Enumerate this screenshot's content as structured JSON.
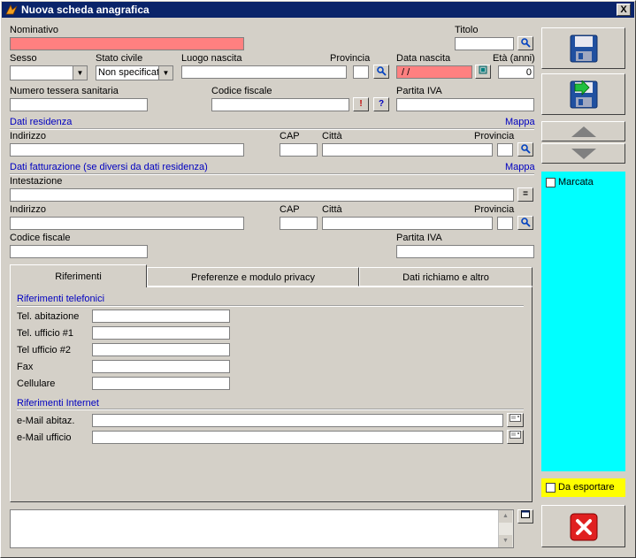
{
  "window": {
    "title": "Nuova scheda anagrafica",
    "close_label": "X"
  },
  "labels": {
    "nominativo": "Nominativo",
    "titolo": "Titolo",
    "sesso": "Sesso",
    "stato_civile": "Stato civile",
    "luogo_nascita": "Luogo nascita",
    "provincia": "Provincia",
    "data_nascita": "Data nascita",
    "eta": "Età (anni)",
    "numero_tessera": "Numero tessera sanitaria",
    "codice_fiscale": "Codice fiscale",
    "partita_iva": "Partita IVA",
    "dati_residenza": "Dati residenza",
    "mappa": "Mappa",
    "indirizzo": "Indirizzo",
    "cap": "CAP",
    "citta": "Città",
    "dati_fatturazione": "Dati fatturazione (se diversi da dati residenza)",
    "intestazione": "Intestazione"
  },
  "values": {
    "stato_civile": "Non specificato",
    "data_nascita": " / /",
    "eta": "0"
  },
  "buttons": {
    "cf_warning": "!",
    "cf_help": "?",
    "equals": "="
  },
  "tabs": [
    {
      "label": "Riferimenti"
    },
    {
      "label": "Preferenze e modulo privacy"
    },
    {
      "label": "Dati richiamo e altro"
    }
  ],
  "riferimenti": {
    "telefonici_title": "Riferimenti telefonici",
    "tel_abitazione": "Tel. abitazione",
    "tel_ufficio1": "Tel. ufficio #1",
    "tel_ufficio2": "Tel ufficio #2",
    "fax": "Fax",
    "cellulare": "Cellulare",
    "internet_title": "Riferimenti Internet",
    "email_abitaz": "e-Mail abitaz.",
    "email_ufficio": "e-Mail ufficio"
  },
  "side": {
    "marcata": "Marcata",
    "da_esportare": "Da esportare"
  },
  "colors": {
    "cyan_panel": "#00ffff",
    "yellow_panel": "#ffff00",
    "required_field": "#ff8080",
    "title_bar": "#0a246a"
  },
  "icons": [
    "app-icon",
    "search-icon",
    "save-icon",
    "save-new-icon",
    "arrow-up-icon",
    "arrow-down-icon",
    "calendar-icon",
    "email-icon",
    "cancel-icon",
    "window-icon"
  ]
}
